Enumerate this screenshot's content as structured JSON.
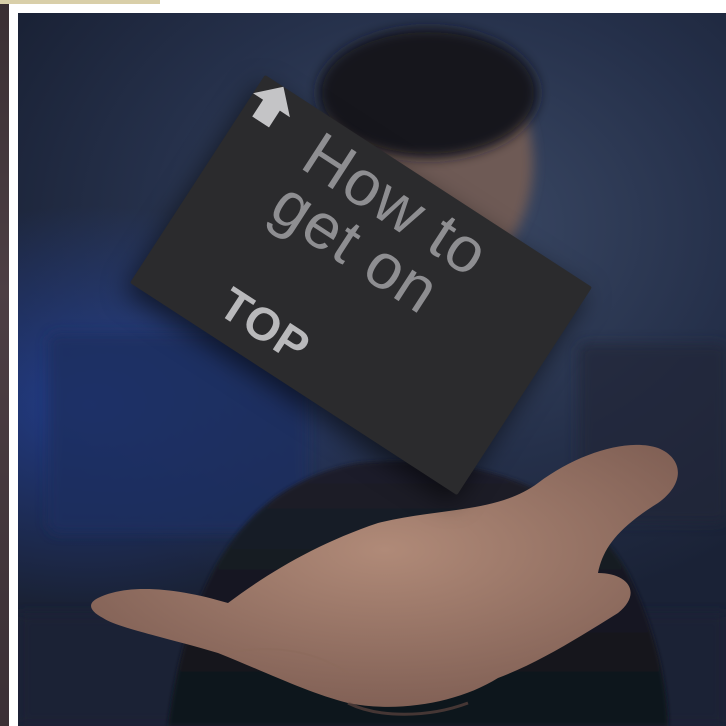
{
  "card": {
    "title": "How to\nget on",
    "badge": "TOP"
  },
  "icons": {
    "arrow": "up-arrow-icon"
  },
  "colors": {
    "card": "#2b2b2d",
    "card_text": "#8e8e91",
    "background": "#25304a",
    "blue_glow": "#2850c8"
  }
}
